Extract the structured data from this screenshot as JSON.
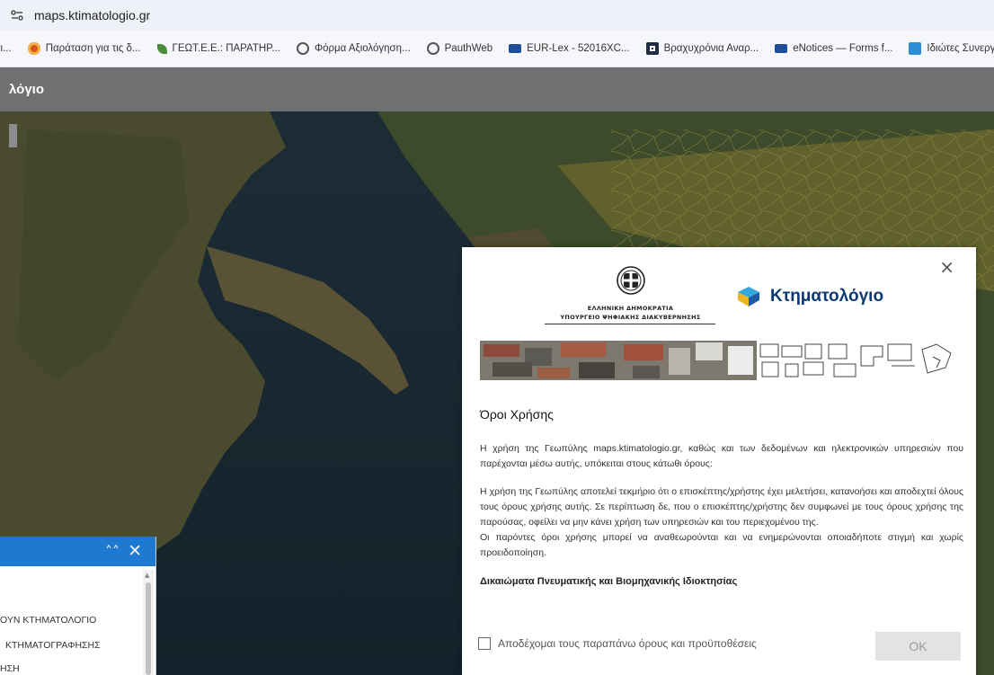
{
  "browser": {
    "url": "maps.ktimatologio.gr",
    "bookmarks": [
      {
        "label": "τι...",
        "icon": "",
        "color": "#888888"
      },
      {
        "label": "Παράταση για τις δ...",
        "icon": "fire-icon",
        "color": "#d9541e"
      },
      {
        "label": "ΓΕΩΤ.Ε.Ε.: ΠΑΡΑΤΗΡ...",
        "icon": "leaf-icon",
        "color": "#4b8b3b"
      },
      {
        "label": "Φόρμα Αξιολόγηση...",
        "icon": "globe-icon",
        "color": "#555555"
      },
      {
        "label": "PauthWeb",
        "icon": "globe-icon",
        "color": "#555555"
      },
      {
        "label": "EUR-Lex - 52016XC...",
        "icon": "monitor-icon",
        "color": "#1f4e9a"
      },
      {
        "label": "Βραχυχρόνια Αναρ...",
        "icon": "camera-icon",
        "color": "#1f2a44"
      },
      {
        "label": "eNotices — Forms f...",
        "icon": "monitor-icon",
        "color": "#1f4e9a"
      },
      {
        "label": "Ιδιώτες Συνεργάτ",
        "icon": "square-icon",
        "color": "#2c8fd6"
      }
    ]
  },
  "app": {
    "title": "λόγιο"
  },
  "left_panel": {
    "items": [
      "ΟΥΝ ΚΤΗΜΑΤΟΛΟΓΙΟ",
      "ΚΤΗΜΑΤΟΓΡΑΦΗΣΗΣ",
      "ΗΣΗ"
    ]
  },
  "dialog": {
    "gov_line1": "ΕΛΛΗΝΙΚΗ ΔΗΜΟΚΡΑΤΙΑ",
    "gov_line2": "ΥΠΟΥΡΓΕΙΟ ΨΗΦΙΑΚΗΣ ΔΙΑΚΥΒΕΡΝΗΣΗΣ",
    "brand_name": "Κτηματολόγιο",
    "heading": "Όροι Χρήσης",
    "para1": "Η χρήση της Γεωπύλης maps.ktimatologio.gr, καθώς και των δεδομένων και ηλεκτρονικών υπηρεσιών που παρέχονται μέσω αυτής, υπόκειται στους κάτωθι όρους:",
    "para2": "Η χρήση της Γεωπύλης αποτελεί τεκμήριο ότι ο επισκέπτης/χρήστης έχει μελετήσει, κατανοήσει και αποδεχτεί όλους τους όρους χρήσης αυτής. Σε περίπτωση δε, που ο επισκέπτης/χρήστης δεν συμφωνεί με τους όρους χρήσης της παρούσας, οφείλει να μην κάνει χρήση των υπηρεσιών και του περιεχομένου της.",
    "para3": "Οι παρόντες όροι χρήσης μπορεί να αναθεωρούνται και να ενημερώνονται οποιαδήποτε στιγμή και χωρίς προειδοποίηση.",
    "subheading": "Δικαιώματα Πνευματικής και Βιομηχανικής Ιδιοκτησίας",
    "accept_label": "Αποδέχομαι τους παραπάνω όρους και προϋποθέσεις",
    "accept_checked": false,
    "ok_label": "OK",
    "close_symbol": "×"
  },
  "colors": {
    "header_bg": "#6f7072",
    "panel_header": "#1e79d1",
    "brand_text": "#0d3a6e"
  }
}
